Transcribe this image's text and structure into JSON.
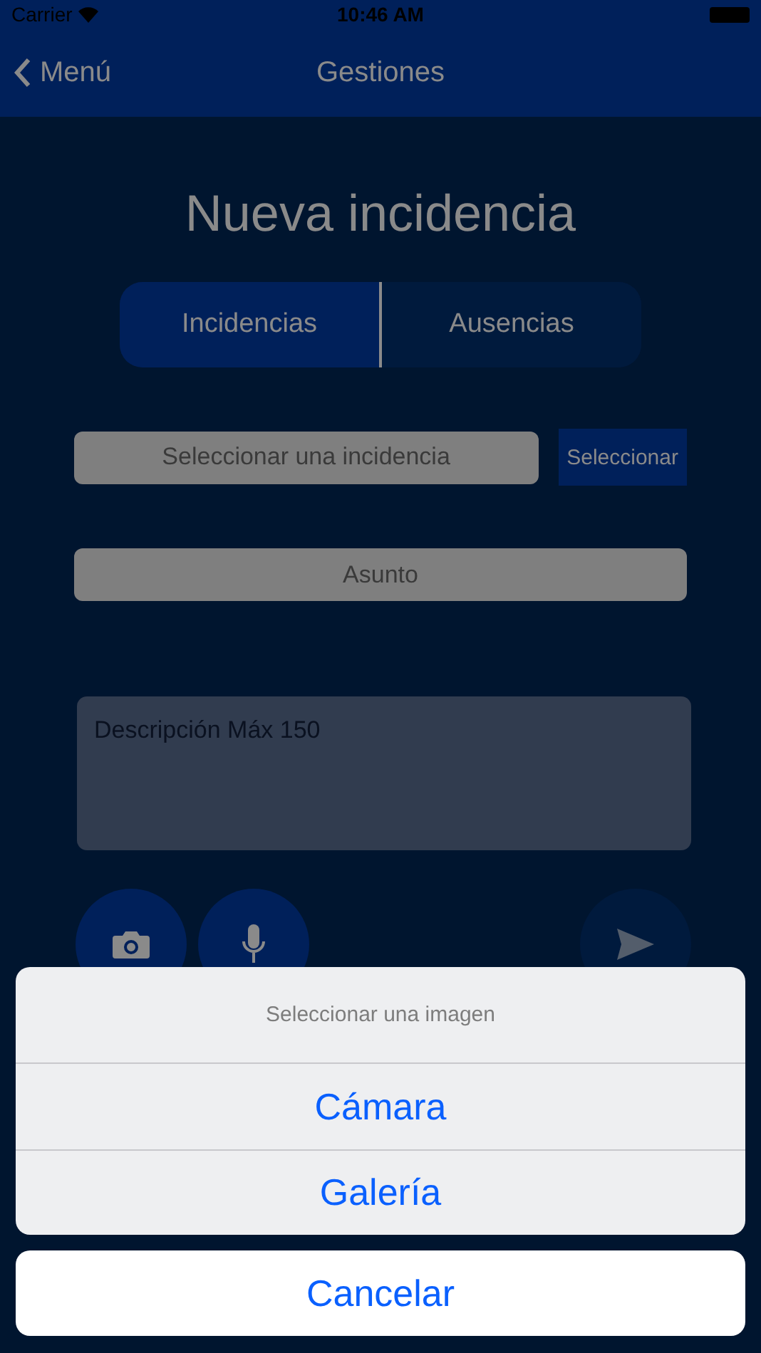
{
  "status_bar": {
    "carrier": "Carrier",
    "time": "10:46 AM"
  },
  "nav": {
    "back_label": "Menú",
    "title": "Gestiones"
  },
  "form": {
    "heading": "Nueva incidencia",
    "tabs": [
      {
        "label": "Incidencias",
        "selected": true
      },
      {
        "label": "Ausencias",
        "selected": false
      }
    ],
    "incident_field": {
      "placeholder": "Seleccionar una incidencia"
    },
    "select_button": "Seleccionar",
    "subject_field": {
      "placeholder": "Asunto"
    },
    "description_field": {
      "placeholder": "Descripción Máx 150"
    },
    "actions": [
      {
        "kind": "camera",
        "disabled": false
      },
      {
        "kind": "microphone",
        "disabled": false
      },
      {
        "kind": "send",
        "disabled": true
      }
    ]
  },
  "action_sheet": {
    "title": "Seleccionar una imagen",
    "options": [
      "Cámara",
      "Galería"
    ],
    "cancel": "Cancelar"
  }
}
